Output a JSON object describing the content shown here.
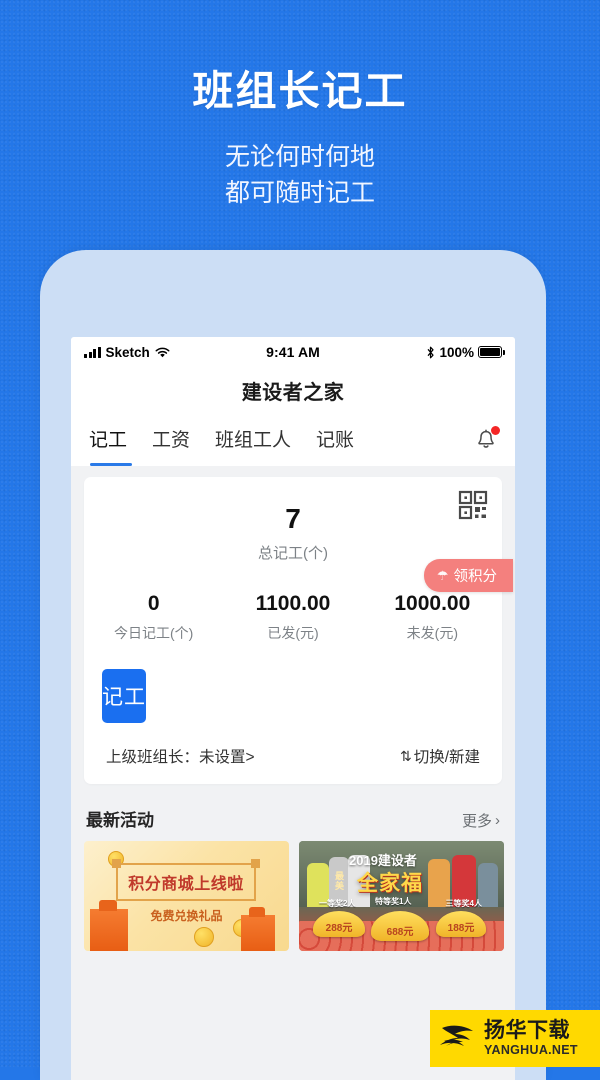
{
  "hero": {
    "title": "班组长记工",
    "subtitle_line1": "无论何时何地",
    "subtitle_line2": "都可随时记工"
  },
  "status_bar": {
    "carrier": "Sketch",
    "time": "9:41 AM",
    "battery_percent": "100%",
    "icons": [
      "signal-icon",
      "wifi-icon",
      "bluetooth-icon",
      "battery-icon"
    ]
  },
  "header": {
    "title": "建设者之家"
  },
  "tabs": [
    {
      "label": "记工",
      "active": true
    },
    {
      "label": "工资",
      "active": false
    },
    {
      "label": "班组工人",
      "active": false
    },
    {
      "label": "记账",
      "active": false
    }
  ],
  "notification": {
    "icon": "bell-icon",
    "has_badge": true
  },
  "main_card": {
    "qr_icon": "qr-code-icon",
    "total_value": "7",
    "total_label": "总记工(个)",
    "points_pill": {
      "icon": "gift-icon",
      "label": "领积分"
    },
    "stats": [
      {
        "value": "0",
        "label": "今日记工(个)"
      },
      {
        "value": "1100.00",
        "label": "已发(元)"
      },
      {
        "value": "1000.00",
        "label": "未发(元)"
      }
    ],
    "record_button": "记工",
    "leader_text": "上级班组长：未设置>",
    "switch_icon": "⇅",
    "switch_label": "切换/新建"
  },
  "activity": {
    "title": "最新活动",
    "more_label": "更多",
    "more_chevron": "›",
    "cards": [
      {
        "title": "积分商城上线啦",
        "subtitle": "免费兑换礼品"
      },
      {
        "title": "2019建设者",
        "tag_line1": "最",
        "tag_line2": "美",
        "big_title": "全家福",
        "prices": [
          "288元",
          "688元",
          "188元"
        ],
        "captions": [
          "一等奖2人",
          "特等奖1人",
          "三等奖4人"
        ]
      }
    ]
  },
  "watermark": {
    "cn": "扬华下载",
    "en": "YANGHUA.NET"
  },
  "colors": {
    "background_blue": "#2477e8",
    "accent_blue": "#1a6ff0",
    "tab_underline": "#2a7ae8",
    "pill_pink": "#f4807e",
    "badge_red": "#f42626",
    "phone_bezel": "#ccdef5",
    "screen_bg": "#f1f2f4",
    "watermark_yellow": "#ffd900"
  }
}
